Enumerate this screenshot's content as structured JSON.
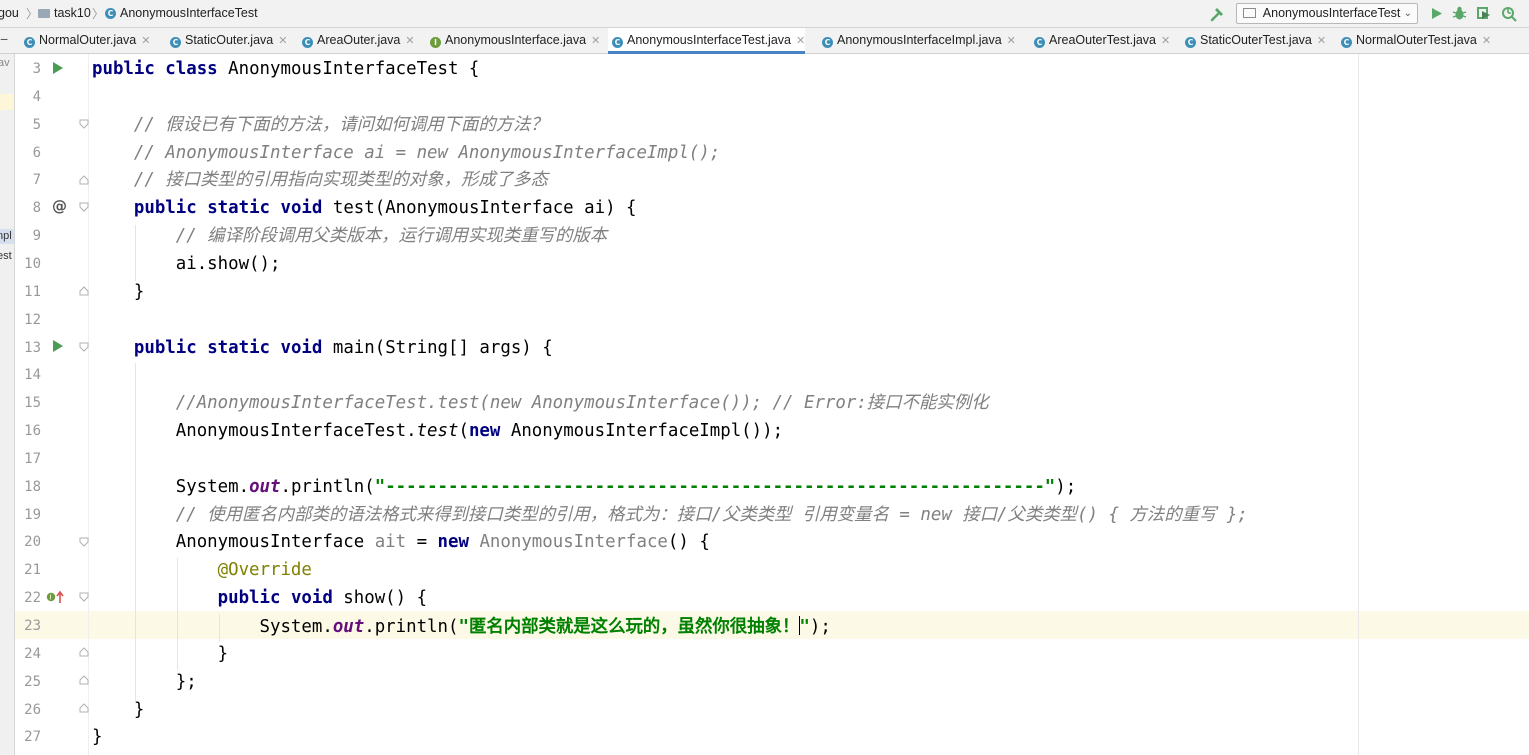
{
  "breadcrumb": {
    "items": [
      "gou",
      "task10",
      "AnonymousInterfaceTest"
    ]
  },
  "toolbar": {
    "run_configuration": "AnonymousInterfaceTest"
  },
  "icons": {
    "build": "hammer-icon",
    "run": "run-icon",
    "debug": "debug-icon",
    "coverage": "coverage-icon",
    "profile": "profile-icon"
  },
  "colors": {
    "keyword": "#000080",
    "comment": "#808080",
    "string": "#008000",
    "annotation": "#808000",
    "static_field": "#660e7a",
    "line_number": "#999999",
    "current_line": "#fcfae6",
    "active_tab_underline": "#4a83c4"
  },
  "tabs": [
    {
      "label": "NormalOuter.java",
      "kind": "class",
      "active": false
    },
    {
      "label": "StaticOuter.java",
      "kind": "class",
      "active": false
    },
    {
      "label": "AreaOuter.java",
      "kind": "class",
      "active": false
    },
    {
      "label": "AnonymousInterface.java",
      "kind": "interface",
      "active": false
    },
    {
      "label": "AnonymousInterfaceTest.java",
      "kind": "class",
      "active": true
    },
    {
      "label": "AnonymousInterfaceImpl.java",
      "kind": "class",
      "active": false
    },
    {
      "label": "AreaOuterTest.java",
      "kind": "class",
      "active": false
    },
    {
      "label": "StaticOuterTest.java",
      "kind": "class",
      "active": false
    },
    {
      "label": "NormalOuterTest.java",
      "kind": "class",
      "active": false
    }
  ],
  "project_strip": {
    "fragments": [
      "av",
      "npl",
      "est"
    ]
  },
  "editor": {
    "file": "AnonymousInterfaceTest.java",
    "caret_line": 23,
    "lines": [
      {
        "n": 3,
        "tokens": [
          [
            "kw",
            "public "
          ],
          [
            "kw",
            "class "
          ],
          [
            "",
            "AnonymousInterfaceTest {"
          ]
        ]
      },
      {
        "n": 4,
        "tokens": []
      },
      {
        "n": 5,
        "tokens": [
          [
            "",
            "    "
          ],
          [
            "cm",
            "// 假设已有下面的方法，请问如何调用下面的方法？"
          ]
        ]
      },
      {
        "n": 6,
        "tokens": [
          [
            "",
            "    "
          ],
          [
            "cm",
            "// AnonymousInterface ai = new AnonymousInterfaceImpl();"
          ]
        ]
      },
      {
        "n": 7,
        "tokens": [
          [
            "",
            "    "
          ],
          [
            "cm",
            "// 接口类型的引用指向实现类型的对象，形成了多态"
          ]
        ]
      },
      {
        "n": 8,
        "tokens": [
          [
            "",
            "    "
          ],
          [
            "kw",
            "public "
          ],
          [
            "kw",
            "static "
          ],
          [
            "kw",
            "void "
          ],
          [
            "",
            "test(AnonymousInterface ai) {"
          ]
        ]
      },
      {
        "n": 9,
        "tokens": [
          [
            "",
            "        "
          ],
          [
            "cm",
            "// 编译阶段调用父类版本，运行调用实现类重写的版本"
          ]
        ]
      },
      {
        "n": 10,
        "tokens": [
          [
            "",
            "        ai.show();"
          ]
        ]
      },
      {
        "n": 11,
        "tokens": [
          [
            "",
            "    }"
          ]
        ]
      },
      {
        "n": 12,
        "tokens": []
      },
      {
        "n": 13,
        "tokens": [
          [
            "",
            "    "
          ],
          [
            "kw",
            "public "
          ],
          [
            "kw",
            "static "
          ],
          [
            "kw",
            "void "
          ],
          [
            "",
            "main(String[] args) {"
          ]
        ]
      },
      {
        "n": 14,
        "tokens": []
      },
      {
        "n": 15,
        "tokens": [
          [
            "",
            "        "
          ],
          [
            "cm",
            "//AnonymousInterfaceTest.test(new AnonymousInterface()); // Error:接口不能实例化"
          ]
        ]
      },
      {
        "n": 16,
        "tokens": [
          [
            "",
            "        AnonymousInterfaceTest."
          ],
          [
            "st",
            "test"
          ],
          [
            "",
            "("
          ],
          [
            "kw",
            "new "
          ],
          [
            "",
            "AnonymousInterfaceImpl());"
          ]
        ]
      },
      {
        "n": 17,
        "tokens": []
      },
      {
        "n": 18,
        "tokens": [
          [
            "",
            "        System."
          ],
          [
            "fld",
            "out"
          ],
          [
            "",
            ".println("
          ],
          [
            "str",
            "\"---------------------------------------------------------------\""
          ],
          [
            "",
            ");"
          ]
        ]
      },
      {
        "n": 19,
        "tokens": [
          [
            "",
            "        "
          ],
          [
            "cm",
            "// 使用匿名内部类的语法格式来得到接口类型的引用，格式为：接口/父类类型 引用变量名 = new 接口/父类类型() { 方法的重写 };"
          ]
        ]
      },
      {
        "n": 20,
        "tokens": [
          [
            "",
            "        AnonymousInterface "
          ],
          [
            "unused",
            "ait"
          ],
          [
            "",
            " = "
          ],
          [
            "kw",
            "new "
          ],
          [
            "unused",
            "AnonymousInterface"
          ],
          [
            "",
            "() {"
          ]
        ]
      },
      {
        "n": 21,
        "tokens": [
          [
            "",
            "            "
          ],
          [
            "ann",
            "@Override"
          ]
        ]
      },
      {
        "n": 22,
        "tokens": [
          [
            "",
            "            "
          ],
          [
            "kw",
            "public "
          ],
          [
            "kw",
            "void "
          ],
          [
            "",
            "show() {"
          ]
        ]
      },
      {
        "n": 23,
        "tokens": [
          [
            "",
            "                System."
          ],
          [
            "fld",
            "out"
          ],
          [
            "",
            ".println("
          ],
          [
            "str",
            "\"匿名内部类就是这么玩的，虽然你很抽象！"
          ],
          [
            "caret",
            ""
          ],
          [
            "str",
            "\""
          ],
          [
            "",
            ");"
          ]
        ]
      },
      {
        "n": 24,
        "tokens": [
          [
            "",
            "            }"
          ]
        ]
      },
      {
        "n": 25,
        "tokens": [
          [
            "",
            "        };"
          ]
        ]
      },
      {
        "n": 26,
        "tokens": [
          [
            "",
            "    }"
          ]
        ]
      },
      {
        "n": 27,
        "tokens": [
          [
            "",
            "}"
          ]
        ]
      }
    ]
  }
}
